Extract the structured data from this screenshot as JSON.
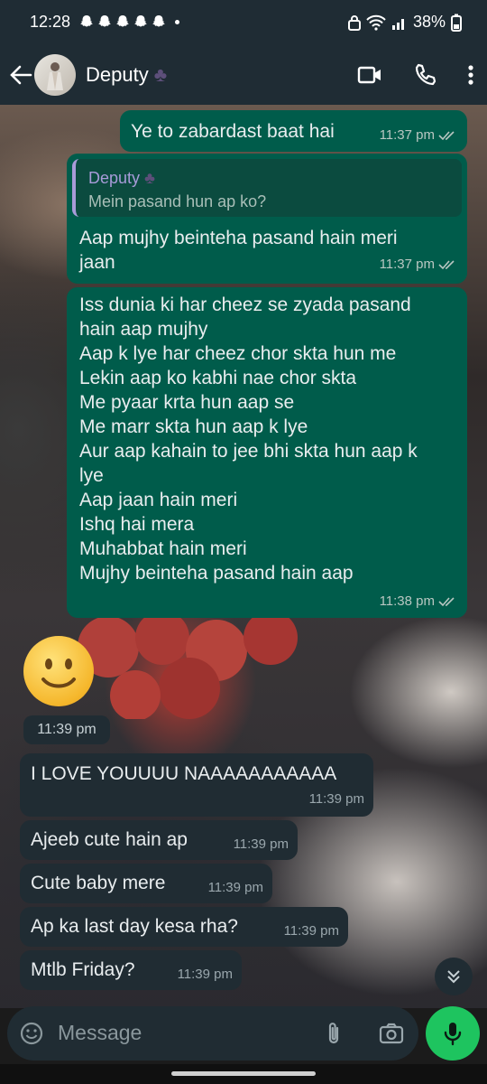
{
  "status_bar": {
    "time": "12:28",
    "battery": "38%"
  },
  "header": {
    "contact_name": "Deputy",
    "club_glyph": "♣"
  },
  "messages": {
    "m1": {
      "text": "Ye to zabardast baat hai",
      "time": "11:37 pm"
    },
    "m2": {
      "quote_name": "Deputy",
      "quote_text": "Mein pasand hun ap ko?",
      "line1": "Aap mujhy beinteha pasand hain meri",
      "line2": "jaan",
      "time": "11:37 pm"
    },
    "m3": {
      "lines": [
        "Iss dunia ki har cheez se zyada pasand",
        "hain aap mujhy",
        "Aap k lye har cheez chor skta hun me",
        "Lekin aap ko kabhi nae chor skta",
        "Me pyaar krta hun aap se",
        "Me marr skta hun aap k lye",
        "Aur aap kahain to jee bhi skta hun aap k",
        "lye",
        "Aap jaan hain meri",
        "Ishq hai mera",
        "Muhabbat hain meri",
        "Mujhy beinteha pasand hain aap"
      ],
      "time": "11:38 pm"
    },
    "emoji_time": "11:39 pm",
    "m4": {
      "text": "I LOVE YOUUUU NAAAAAAAAAAA",
      "time": "11:39 pm"
    },
    "m5": {
      "text": "Ajeeb cute hain ap",
      "time": "11:39 pm"
    },
    "m6": {
      "text": "Cute baby mere",
      "time": "11:39 pm"
    },
    "m7": {
      "text": "Ap ka last day kesa rha?",
      "time": "11:39 pm"
    },
    "m8": {
      "text": "Mtlb Friday?",
      "time": "11:39 pm"
    }
  },
  "composer": {
    "placeholder": "Message"
  },
  "colors": {
    "outgoing": "#005c4b",
    "incoming": "#202c33",
    "accent": "#1ec45f",
    "quote_name": "#a89bd9"
  },
  "icons": [
    "back-arrow-icon",
    "video-call-icon",
    "phone-icon",
    "more-icon",
    "emoji-icon",
    "attach-icon",
    "camera-icon",
    "mic-icon",
    "double-check-icon",
    "chevron-double-down-icon"
  ]
}
